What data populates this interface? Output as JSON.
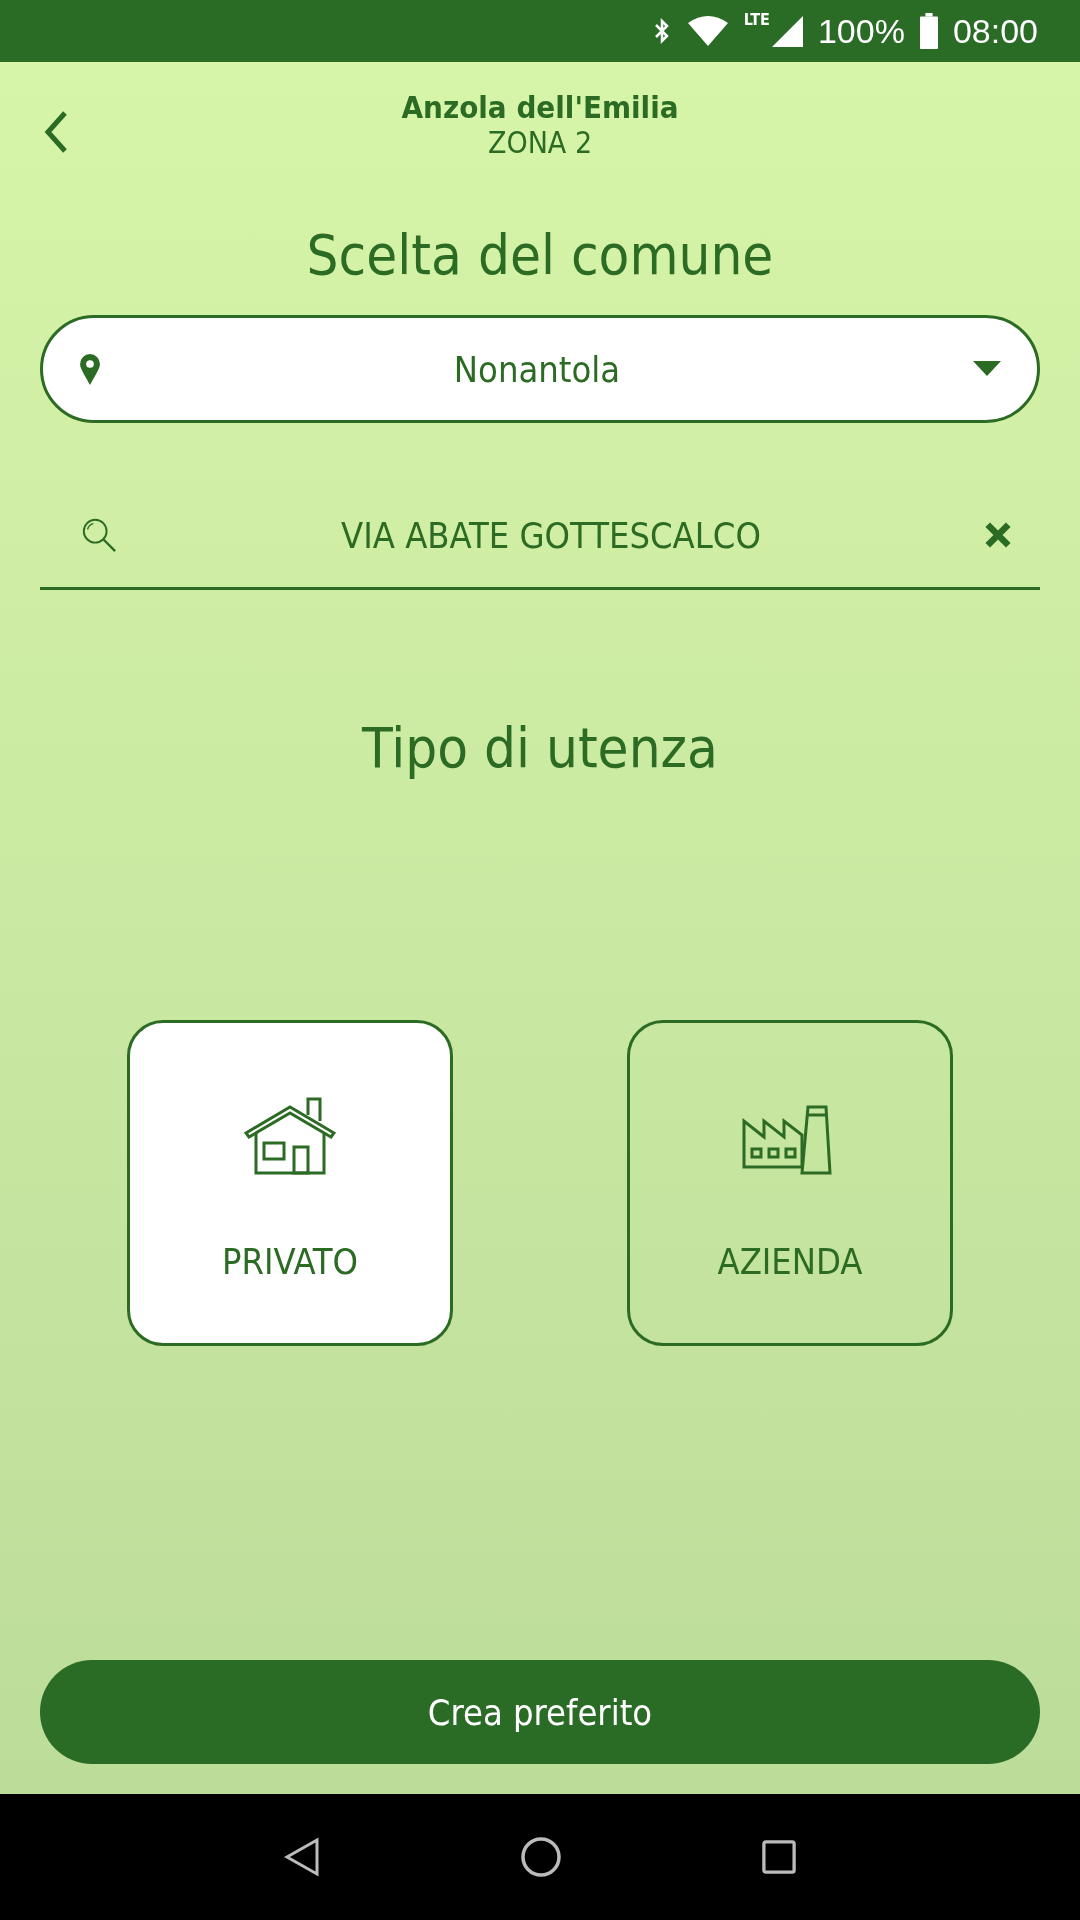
{
  "status_bar": {
    "network": "LTE",
    "battery": "100%",
    "time": "08:00"
  },
  "header": {
    "title": "Anzola dell'Emilia",
    "subtitle": "ZONA 2"
  },
  "municipality": {
    "heading": "Scelta del comune",
    "value": "Nonantola"
  },
  "search": {
    "value": "VIA ABATE GOTTESCALCO"
  },
  "user_type": {
    "heading": "Tipo di utenza",
    "options": [
      {
        "label": "PRIVATO",
        "kind": "house",
        "selected": true
      },
      {
        "label": "AZIENDA",
        "kind": "factory",
        "selected": false
      }
    ]
  },
  "primary_button": "Crea preferito"
}
